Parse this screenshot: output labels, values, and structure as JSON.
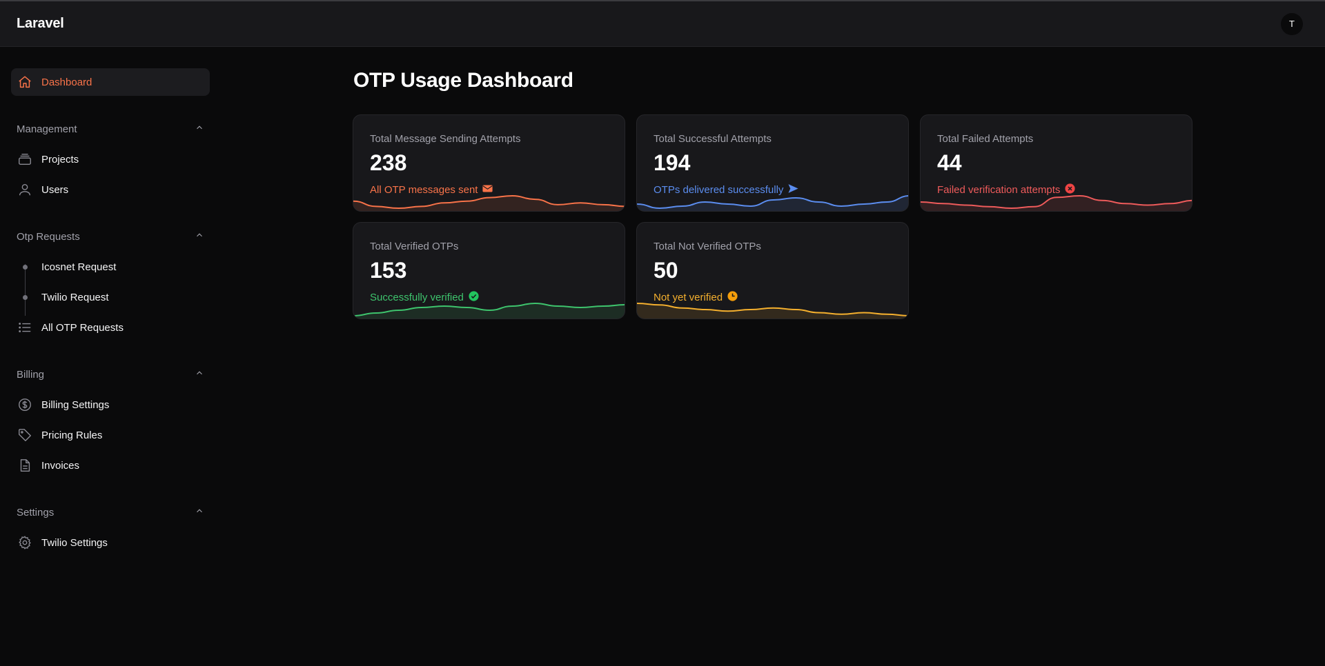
{
  "app": {
    "brand": "Laravel",
    "avatar_initial": "T"
  },
  "sidebar": {
    "dashboard": {
      "label": "Dashboard",
      "icon": "home-icon"
    },
    "groups": {
      "management": {
        "title": "Management",
        "items": [
          {
            "label": "Projects",
            "icon": "stack-icon"
          },
          {
            "label": "Users",
            "icon": "user-icon"
          }
        ]
      },
      "otp": {
        "title": "Otp Requests",
        "items": [
          {
            "label": "Icosnet Request",
            "icon": "tree-dot"
          },
          {
            "label": "Twilio Request",
            "icon": "tree-dot"
          },
          {
            "label": "All OTP Requests",
            "icon": "list-icon"
          }
        ]
      },
      "billing": {
        "title": "Billing",
        "items": [
          {
            "label": "Billing Settings",
            "icon": "dollar-circle-icon"
          },
          {
            "label": "Pricing Rules",
            "icon": "tag-icon"
          },
          {
            "label": "Invoices",
            "icon": "document-icon"
          }
        ]
      },
      "settings": {
        "title": "Settings",
        "items": [
          {
            "label": "Twilio Settings",
            "icon": "gear-icon"
          }
        ]
      }
    }
  },
  "main": {
    "title": "OTP Usage Dashboard",
    "cards": [
      {
        "label": "Total Message Sending Attempts",
        "value": "238",
        "desc": "All OTP messages sent",
        "icon": "envelope-icon",
        "color": "#f97349",
        "trend": [
          6,
          3,
          2,
          3,
          5,
          6,
          8,
          9,
          7,
          4,
          5,
          4,
          3
        ]
      },
      {
        "label": "Total Successful Attempts",
        "value": "194",
        "desc": "OTPs delivered successfully",
        "icon": "paper-plane-icon",
        "color": "#5b8def",
        "trend": [
          5,
          3,
          4,
          6,
          5,
          4,
          7,
          8,
          6,
          4,
          5,
          6,
          9
        ]
      },
      {
        "label": "Total Failed Attempts",
        "value": "44",
        "desc": "Failed verification attempts",
        "icon": "x-circle-icon",
        "color": "#ef5b5b",
        "trend": [
          5,
          4,
          3,
          2,
          1,
          2,
          8,
          9,
          6,
          4,
          3,
          4,
          6
        ]
      },
      {
        "label": "Total Verified OTPs",
        "value": "153",
        "desc": "Successfully verified",
        "icon": "check-circle-icon",
        "color": "#3ec46d",
        "trend": [
          3,
          5,
          7,
          9,
          10,
          9,
          7,
          10,
          12,
          10,
          9,
          10,
          11
        ]
      },
      {
        "label": "Total Not Verified OTPs",
        "value": "50",
        "desc": "Not yet verified",
        "icon": "clock-icon",
        "color": "#f5b02e",
        "trend": [
          14,
          13,
          11,
          10,
          9,
          10,
          11,
          10,
          8,
          7,
          8,
          7,
          6
        ]
      }
    ]
  }
}
